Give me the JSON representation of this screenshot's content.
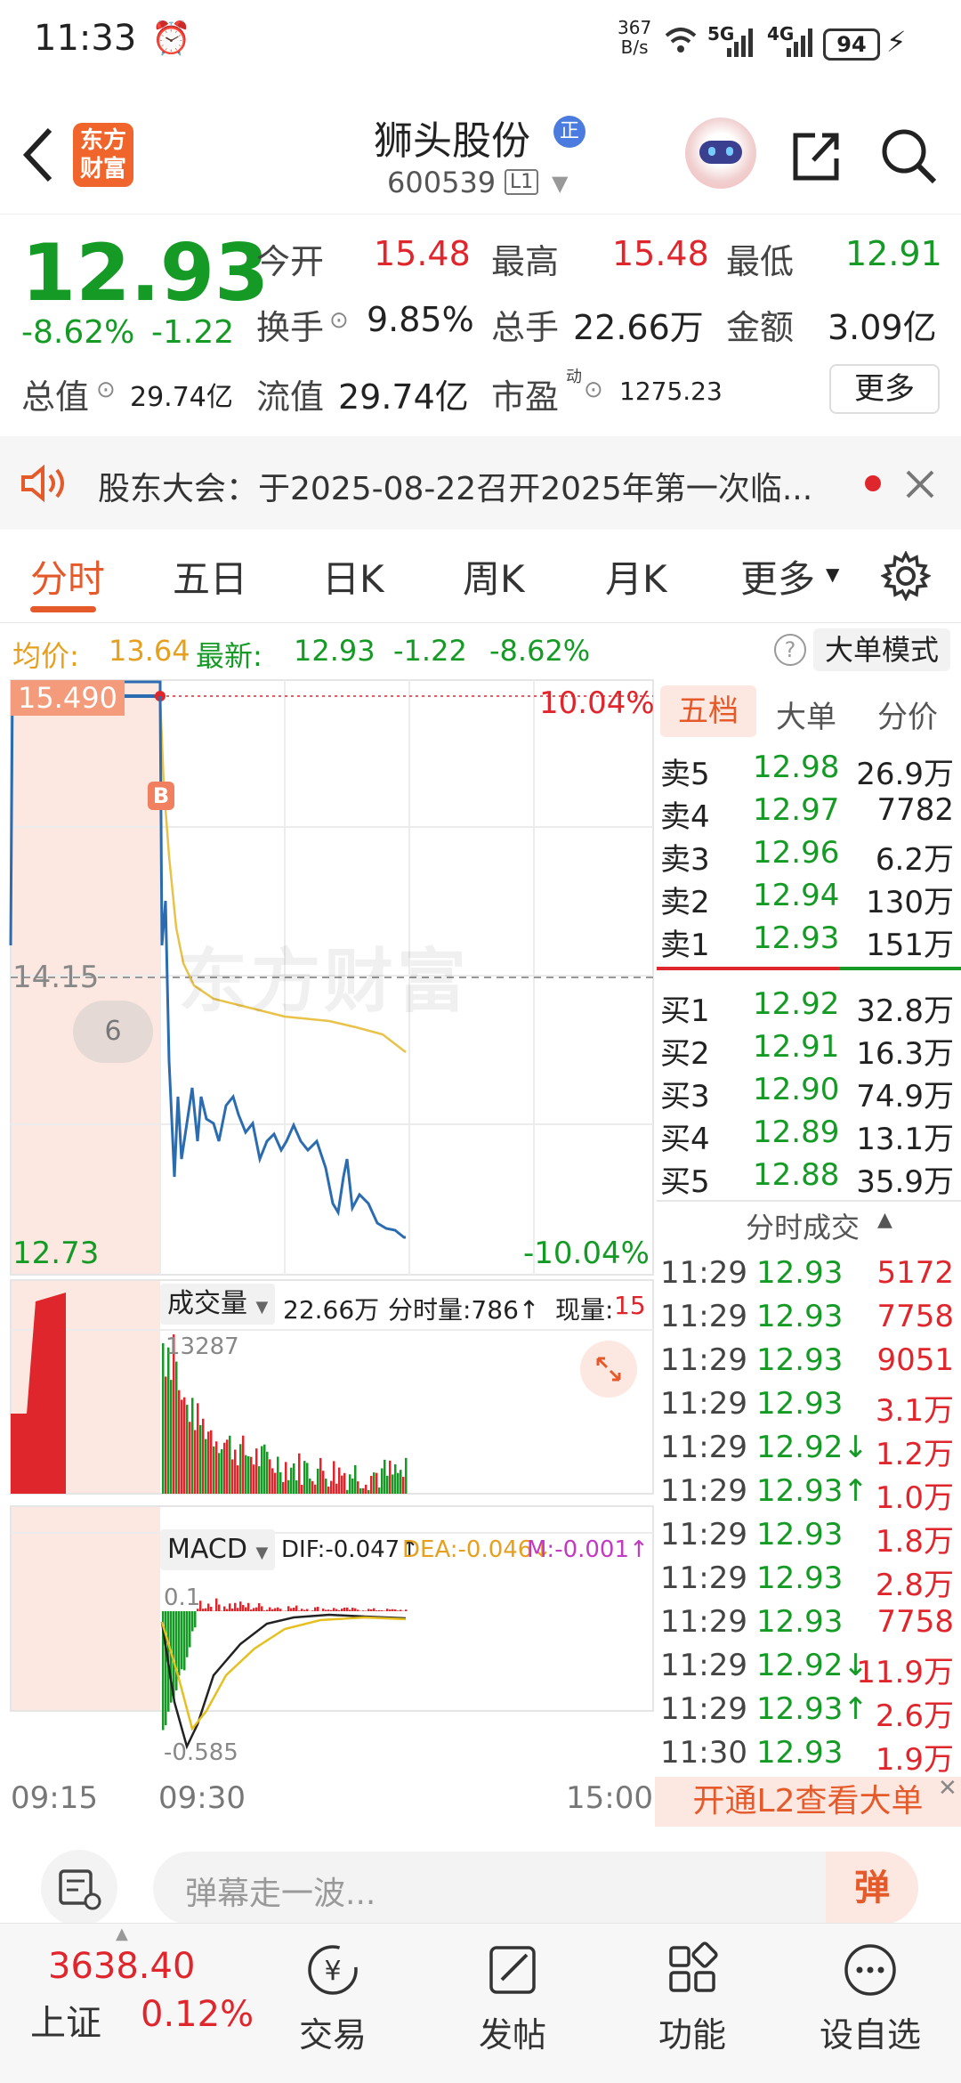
{
  "status": {
    "time": "11:33",
    "net_speed_top": "367",
    "net_speed_unit": "B/s",
    "sig1": "5G",
    "sig2": "4G",
    "battery": "94"
  },
  "header": {
    "stock_name": "狮头股份",
    "badge": "正",
    "code": "600539",
    "level": "L1",
    "logo_top": "东方",
    "logo_bottom": "财富"
  },
  "quote": {
    "price": "12.93",
    "change_pct": "-8.62%",
    "change": "-1.22",
    "open_label": "今开",
    "open": "15.48",
    "high_label": "最高",
    "high": "15.48",
    "low_label": "最低",
    "low": "12.91",
    "turnover_label": "换手",
    "turnover": "9.85%",
    "volume_label": "总手",
    "volume": "22.66万",
    "amount_label": "金额",
    "amount": "3.09亿",
    "mktcap_label": "总值",
    "mktcap": "29.74亿",
    "float_label": "流值",
    "float_cap": "29.74亿",
    "pe_label": "市盈",
    "pe_sup": "动",
    "pe": "1275.23",
    "more": "更多"
  },
  "notice": {
    "text": "股东大会：于2025-08-22召开2025年第一次临..."
  },
  "tabs": [
    "分时",
    "五日",
    "日K",
    "周K",
    "月K",
    "更多"
  ],
  "infobar": {
    "avg_label": "均价:",
    "avg": "13.64",
    "latest_label": "最新:",
    "latest": "12.93",
    "chg": "-1.22",
    "pct": "-8.62%",
    "mode": "大单模式"
  },
  "chart": {
    "high_price": "15.490",
    "high_pct": "10.04%",
    "mid_price": "14.15",
    "low_price": "12.73",
    "low_pct": "-10.04%",
    "watermark": "东方财富",
    "bubble": "6",
    "marker": "B",
    "vol_label": "成交量",
    "vol_total": "22.66万",
    "vol_minute": "分时量:786↑",
    "vol_now_label": "现量:",
    "vol_now": "15",
    "vol_max": "13287",
    "macd_label": "MACD",
    "dif": "DIF:-0.047↑",
    "dea": "DEA:-0.046↓",
    "m": "M:-0.001↑",
    "macd_top": "0.1",
    "macd_bottom": "-0.585",
    "t_start": "09:15",
    "t_open": "09:30",
    "t_end": "15:00"
  },
  "book": {
    "tabs": [
      "五档",
      "大单",
      "分价"
    ],
    "asks": [
      {
        "label": "卖5",
        "price": "12.98",
        "vol": "26.9万"
      },
      {
        "label": "卖4",
        "price": "12.97",
        "vol": "7782"
      },
      {
        "label": "卖3",
        "price": "12.96",
        "vol": "6.2万"
      },
      {
        "label": "卖2",
        "price": "12.94",
        "vol": "130万"
      },
      {
        "label": "卖1",
        "price": "12.93",
        "vol": "151万"
      }
    ],
    "bids": [
      {
        "label": "买1",
        "price": "12.92",
        "vol": "32.8万"
      },
      {
        "label": "买2",
        "price": "12.91",
        "vol": "16.3万"
      },
      {
        "label": "买3",
        "price": "12.90",
        "vol": "74.9万"
      },
      {
        "label": "买4",
        "price": "12.89",
        "vol": "13.1万"
      },
      {
        "label": "买5",
        "price": "12.88",
        "vol": "35.9万"
      }
    ],
    "trades_title": "分时成交",
    "trades": [
      {
        "t": "11:29",
        "p": "12.93",
        "v": "5172"
      },
      {
        "t": "11:29",
        "p": "12.93",
        "v": "7758"
      },
      {
        "t": "11:29",
        "p": "12.93",
        "v": "9051"
      },
      {
        "t": "11:29",
        "p": "12.93",
        "v": "3.1万"
      },
      {
        "t": "11:29",
        "p": "12.92↓",
        "v": "1.2万"
      },
      {
        "t": "11:29",
        "p": "12.93↑",
        "v": "1.0万"
      },
      {
        "t": "11:29",
        "p": "12.93",
        "v": "1.8万"
      },
      {
        "t": "11:29",
        "p": "12.93",
        "v": "2.8万"
      },
      {
        "t": "11:29",
        "p": "12.93",
        "v": "7758"
      },
      {
        "t": "11:29",
        "p": "12.92↓",
        "v": "11.9万"
      },
      {
        "t": "11:29",
        "p": "12.93↑",
        "v": "2.6万"
      },
      {
        "t": "11:30",
        "p": "12.93",
        "v": "1.9万"
      }
    ],
    "l2_banner": "开通L2查看大单"
  },
  "comment": {
    "placeholder": "弹幕走一波...",
    "btn": "弹"
  },
  "index": {
    "value": "3638.40",
    "name": "上证",
    "pct": "0.12%"
  },
  "nav": [
    "交易",
    "发帖",
    "功能",
    "设自选"
  ]
}
